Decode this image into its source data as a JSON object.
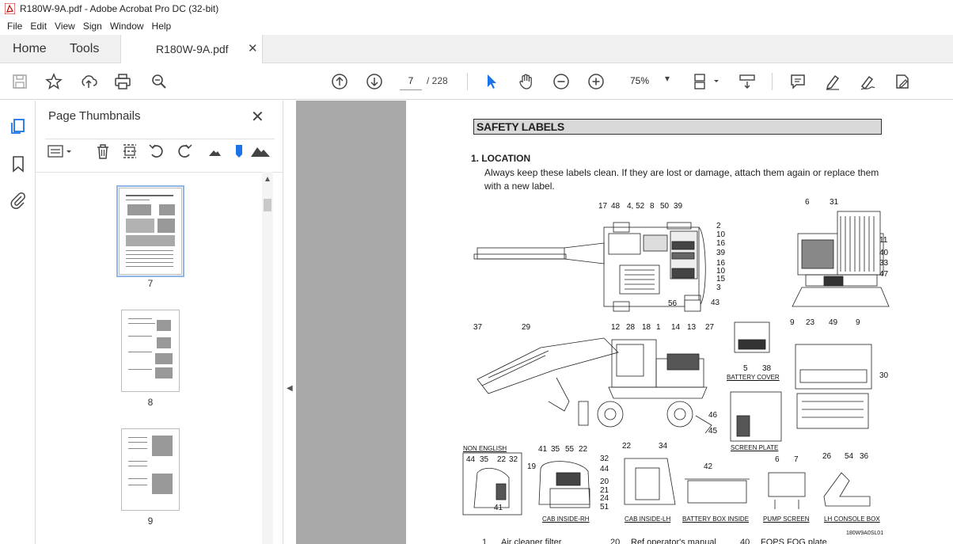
{
  "window": {
    "title": "R180W-9A.pdf - Adobe Acrobat Pro DC (32-bit)"
  },
  "menu": [
    "File",
    "Edit",
    "View",
    "Sign",
    "Window",
    "Help"
  ],
  "tabs": {
    "home": "Home",
    "tools": "Tools",
    "document": "R180W-9A.pdf"
  },
  "toolbar": {
    "current_page": "7",
    "total_pages": "/ 228",
    "zoom": "75%",
    "icons": [
      "save-icon",
      "star-icon",
      "upload-icon",
      "print-icon",
      "zoom-search-icon",
      "page-up-icon",
      "page-down-icon",
      "select-cursor-icon",
      "hand-icon",
      "zoom-out-icon",
      "zoom-in-icon",
      "page-display-icon",
      "scroll-mode-icon",
      "comment-icon",
      "highlight-icon",
      "sign-icon",
      "edit-pdf-icon"
    ]
  },
  "sidebar": {
    "title": "Page Thumbnails",
    "thumbnails": [
      {
        "page": "7"
      },
      {
        "page": "8"
      },
      {
        "page": "9"
      }
    ]
  },
  "document": {
    "section_title": "SAFETY LABELS",
    "location_title": "1.  LOCATION",
    "location_text": "Always keep these labels clean.  If they are lost or damage, attach them again or replace them with a new label.",
    "callouts": [
      "17",
      "48",
      "4, 52",
      "8",
      "50",
      "39",
      "2",
      "10",
      "16",
      "39",
      "16",
      "10",
      "15",
      "3",
      "56",
      "43",
      "6",
      "31",
      "11",
      "40",
      "33",
      "47",
      "37",
      "29",
      "12",
      "28",
      "18",
      "1",
      "14",
      "13",
      "27",
      "5",
      "38",
      "9",
      "23",
      "49",
      "9",
      "30",
      "46",
      "45",
      "44",
      "35",
      "22",
      "32",
      "41",
      "41",
      "35",
      "55",
      "22",
      "19",
      "32",
      "44",
      "20",
      "21",
      "24",
      "51",
      "22",
      "34",
      "42",
      "6",
      "7",
      "26",
      "54",
      "36"
    ],
    "captions": [
      "BATTERY COVER",
      "SCREEN PLATE",
      "NON ENGLISH",
      "CAB INSIDE-RH",
      "CAB INSIDE-LH",
      "BATTERY BOX INSIDE",
      "PUMP SCREEN",
      "LH CONSOLE BOX"
    ],
    "drawing_code": "180W9A0SL01",
    "list_preview": [
      "1",
      "Air cleaner filter",
      "20",
      "Ref operator's manual",
      "40",
      "FOPS FOG plate"
    ]
  }
}
